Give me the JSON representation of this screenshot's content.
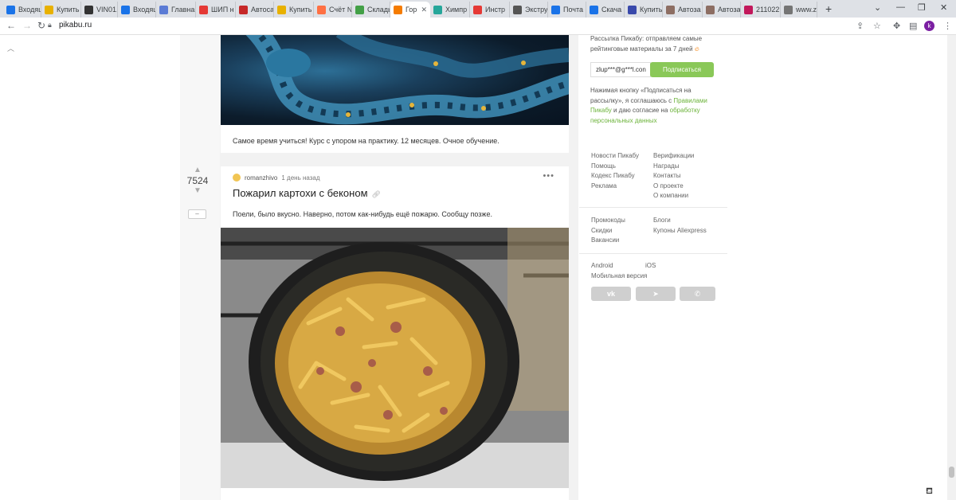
{
  "browser": {
    "tabs": [
      {
        "label": "Входящ",
        "icon": "mail-icon",
        "color": "#1a73e8"
      },
      {
        "label": "Купить",
        "icon": "shop-icon",
        "color": "#e8b100"
      },
      {
        "label": "VIN01.r",
        "icon": "search-icon",
        "color": "#333333"
      },
      {
        "label": "Входящ",
        "icon": "mail-icon",
        "color": "#1a73e8"
      },
      {
        "label": "Главна",
        "icon": "site-icon",
        "color": "#5b7bd5"
      },
      {
        "label": "ШИП н",
        "icon": "yandex-icon",
        "color": "#e53935"
      },
      {
        "label": "Автоса",
        "icon": "site-icon",
        "color": "#c62828"
      },
      {
        "label": "Купить",
        "icon": "shop-icon",
        "color": "#e8b100"
      },
      {
        "label": "Счёт №",
        "icon": "site-icon",
        "color": "#ff7043"
      },
      {
        "label": "Склады",
        "icon": "site-icon",
        "color": "#43a047"
      },
      {
        "label": "Гор",
        "icon": "pikabu-icon",
        "color": "#f57c00"
      },
      {
        "label": "Химпр",
        "icon": "site-icon",
        "color": "#26a69a"
      },
      {
        "label": "Инстр",
        "icon": "site-icon",
        "color": "#e53935"
      },
      {
        "label": "Экстру",
        "icon": "wiki-icon",
        "color": "#555555"
      },
      {
        "label": "Почта",
        "icon": "mail-icon",
        "color": "#1a73e8"
      },
      {
        "label": "Скача",
        "icon": "download-icon",
        "color": "#1a73e8"
      },
      {
        "label": "Купить",
        "icon": "site-icon",
        "color": "#3949ab"
      },
      {
        "label": "Автоза",
        "icon": "site-icon",
        "color": "#8d6e63"
      },
      {
        "label": "Автоза",
        "icon": "site-icon",
        "color": "#8d6e63"
      },
      {
        "label": "211022",
        "icon": "site-icon",
        "color": "#c2185b"
      },
      {
        "label": "www.z",
        "icon": "site-icon",
        "color": "#757575"
      }
    ],
    "url": "pikabu.ru",
    "profile_letter": "k"
  },
  "post_above": {
    "caption": "Самое время учиться! Курс с упором на практику. 12 месяцев. Очное обучение."
  },
  "post": {
    "votes": "7524",
    "collapse_label": "–",
    "author": "romanzhivo",
    "time": "1 день назад",
    "title": "Пожарил картохи с беконом",
    "text": "Поели, было вкусно. Наверно, потом как-нибудь ещё пожарю. Сообщу позже."
  },
  "sidebar": {
    "newsletter_text": "Рассылка Пикабу: отправляем самые рейтинговые материалы за 7 дней",
    "email_value": "zlup***@g***l.con",
    "subscribe_label": "Подписаться",
    "consent_1": "Нажимая кнопку «Подписаться на рассылку», я соглашаюсь с ",
    "consent_link1": "Правилами Пикабу",
    "consent_2": " и даю согласие на ",
    "consent_link2": "обработку персональных данных",
    "links_col1": [
      "Новости Пикабу",
      "Помощь",
      "Кодекс Пикабу",
      "Реклама"
    ],
    "links_col2": [
      "Верификации",
      "Награды",
      "Контакты",
      "О проекте",
      "О компании"
    ],
    "links2_col1": [
      "Промокоды",
      "Скидки",
      "Вакансии"
    ],
    "links2_col2": [
      "Блоги",
      "Купоны Aliexpress"
    ],
    "android": "Android",
    "ios": "iOS",
    "mobile": "Мобильная версия",
    "social": [
      "vk",
      "telegram",
      "viber"
    ]
  }
}
